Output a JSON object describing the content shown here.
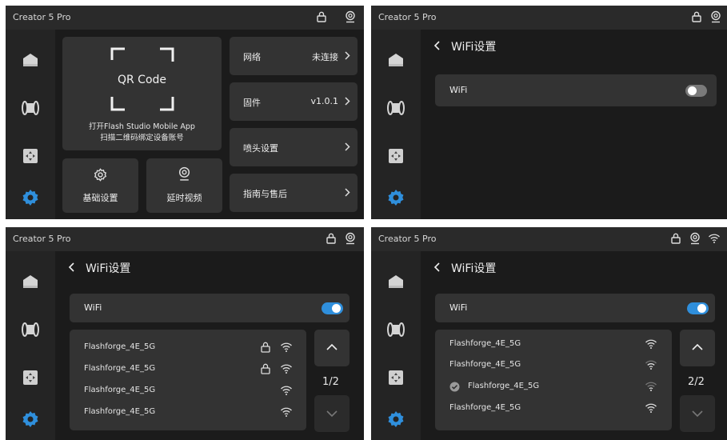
{
  "app_title": "Creator 5 Pro",
  "colors": {
    "accent": "#2f8fdc",
    "panel": "#333333",
    "background": "#1b1b1b",
    "sidebar": "#242424"
  },
  "sidebar_icons": [
    "home-icon",
    "filament-icon",
    "move-control-icon",
    "settings-gear-icon"
  ],
  "screen1": {
    "qr_label": "QR Code",
    "qr_hint_line1": "打开Flash Studio Mobile App",
    "qr_hint_line2": "扫描二维码绑定设备账号",
    "basic_settings": "基础设置",
    "timelapse": "延时视频",
    "menu": [
      {
        "label": "网络",
        "value": "未连接"
      },
      {
        "label": "固件",
        "value": "v1.0.1"
      },
      {
        "label": "喷头设置",
        "value": ""
      },
      {
        "label": "指南与售后",
        "value": ""
      }
    ]
  },
  "screen2": {
    "title": "WiFi设置",
    "wifi_label": "WiFi",
    "wifi_enabled": false
  },
  "screen3": {
    "title": "WiFi设置",
    "wifi_label": "WiFi",
    "wifi_enabled": true,
    "page": "1/2",
    "networks": [
      {
        "name": "Flashforge_4E_5G",
        "locked": true
      },
      {
        "name": "Flashforge_4E_5G",
        "locked": true
      },
      {
        "name": "Flashforge_4E_5G",
        "locked": false
      },
      {
        "name": "Flashforge_4E_5G",
        "locked": false
      }
    ]
  },
  "screen4": {
    "title": "WiFi设置",
    "wifi_label": "WiFi",
    "wifi_enabled": true,
    "page": "2/2",
    "networks": [
      {
        "name": "Flashforge_4E_5G",
        "connected": false
      },
      {
        "name": "Flashforge_4E_5G",
        "connected": false
      },
      {
        "name": "Flashforge_4E_5G",
        "connected": true
      },
      {
        "name": "Flashforge_4E_5G",
        "connected": false
      }
    ]
  }
}
